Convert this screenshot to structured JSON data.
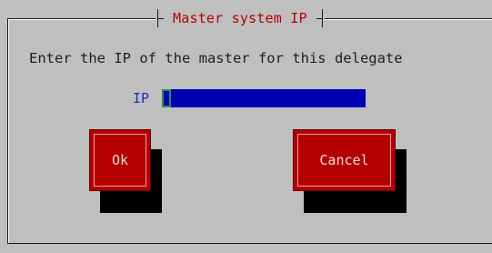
{
  "dialog": {
    "title": "Master system IP",
    "prompt": "Enter the IP of the master for this delegate"
  },
  "ip_field": {
    "label": "IP",
    "value": ""
  },
  "buttons": {
    "ok_label": "Ok",
    "cancel_label": "Cancel"
  },
  "colors": {
    "background": "#bfbfbf",
    "title": "#b40000",
    "label": "#1a2fb0",
    "input_bg": "#0000b4",
    "button_bg": "#b40000",
    "shadow": "#000000"
  }
}
